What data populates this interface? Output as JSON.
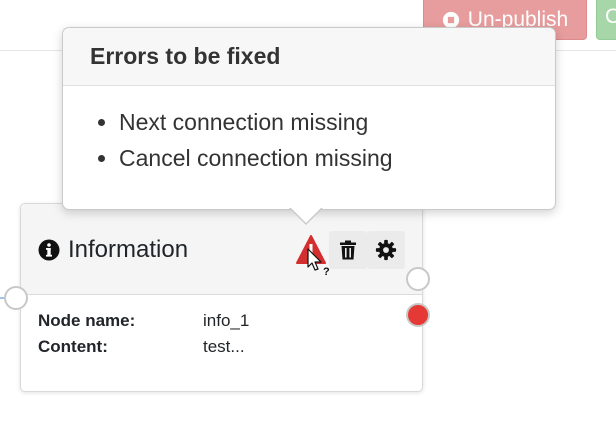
{
  "toolbar": {
    "unpublish_label": "Un-publish",
    "unpublish_icon": "stop-circle-icon",
    "secondary_label": "C",
    "unpublish_color": "#e79d9d",
    "secondary_color": "#a7d7a9"
  },
  "popover": {
    "title": "Errors to be fixed",
    "errors": [
      "Next connection missing",
      "Cancel connection missing"
    ]
  },
  "node": {
    "icon": "info-circle-icon",
    "title": "Information",
    "actions": [
      "warning-icon",
      "trash-icon",
      "gear-icon"
    ],
    "properties": [
      {
        "key": "Node name:",
        "value": "info_1"
      },
      {
        "key": "Content:",
        "value": "test..."
      }
    ],
    "error_port_color": "#e53935",
    "warning_color": "#d32f2f"
  }
}
